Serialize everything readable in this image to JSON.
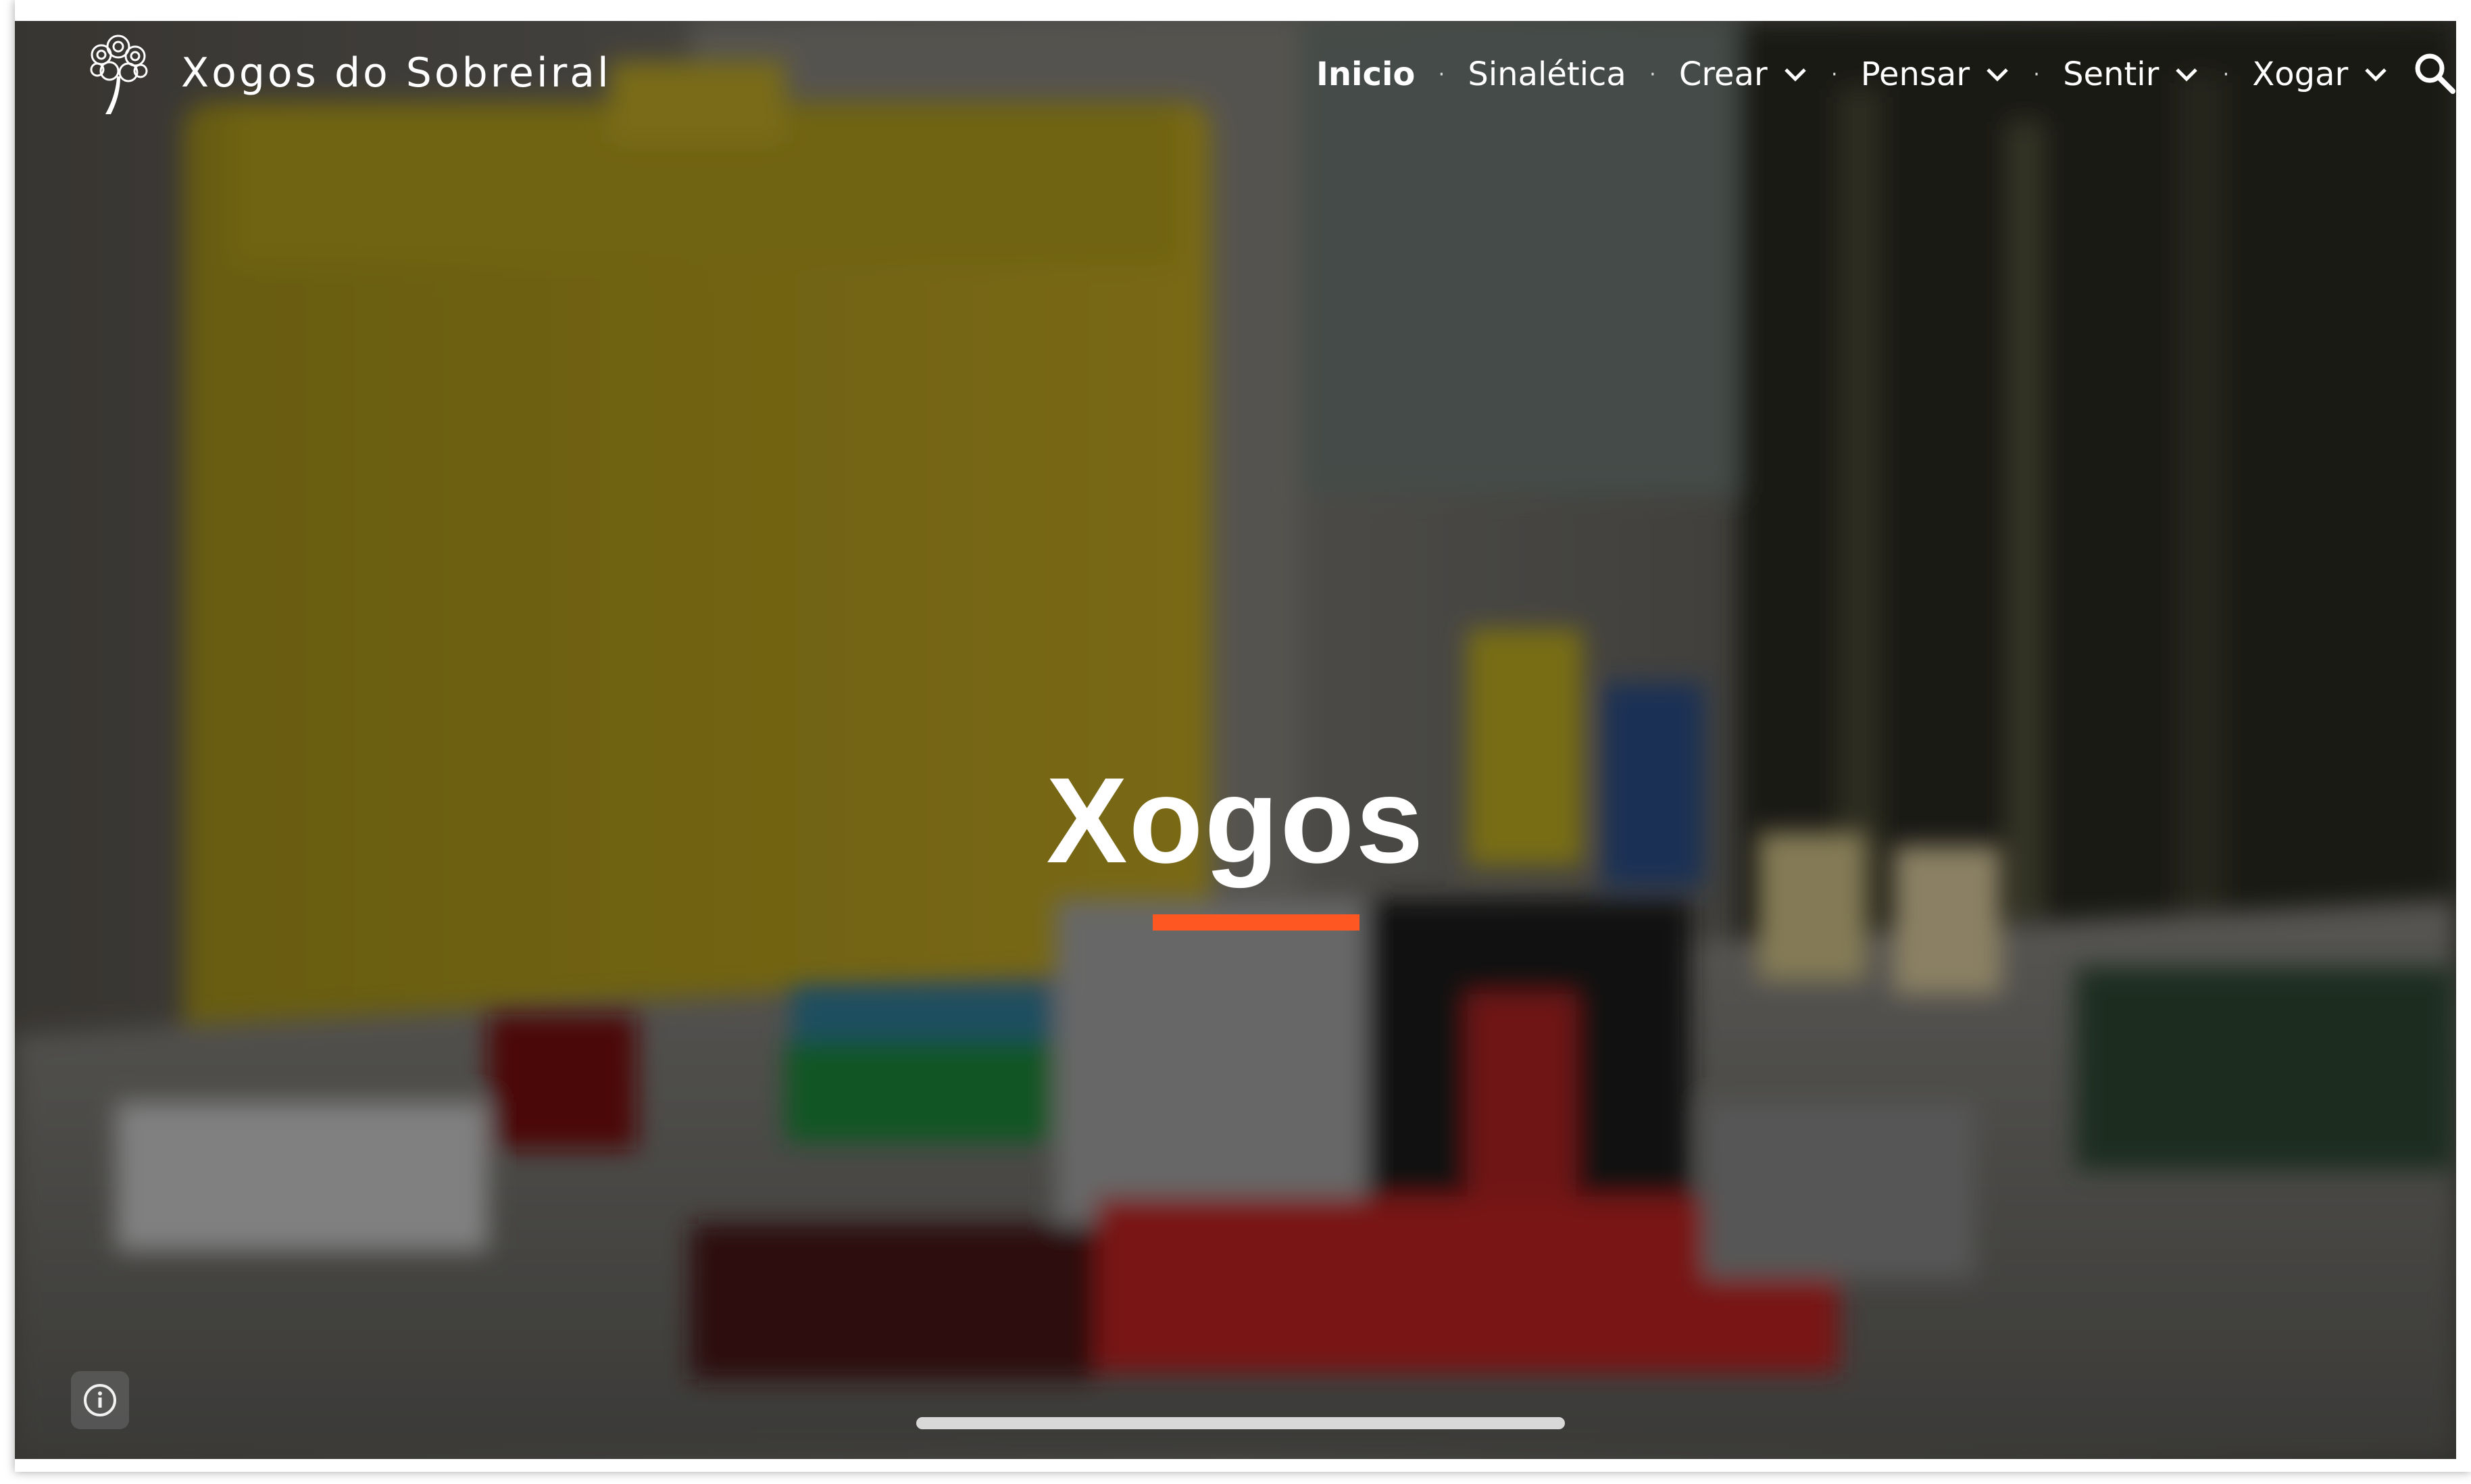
{
  "site": {
    "title": "Xogos do Sobreiral",
    "logo_icon": "cork-oak-tree-icon"
  },
  "nav": {
    "items": [
      {
        "label": "Inicio",
        "active": true,
        "has_dropdown": false
      },
      {
        "label": "Sinalética",
        "active": false,
        "has_dropdown": false
      },
      {
        "label": "Crear",
        "active": false,
        "has_dropdown": true
      },
      {
        "label": "Pensar",
        "active": false,
        "has_dropdown": true
      },
      {
        "label": "Sentir",
        "active": false,
        "has_dropdown": true
      },
      {
        "label": "Xogar",
        "active": false,
        "has_dropdown": true
      }
    ],
    "separator": "·",
    "search_icon": "search-icon"
  },
  "hero": {
    "heading": "Xogos",
    "accent_color": "#ff5722",
    "background": "photo of lego bricks on a baseplate with a yellow storage box"
  },
  "footer": {
    "info_icon": "info-icon"
  }
}
